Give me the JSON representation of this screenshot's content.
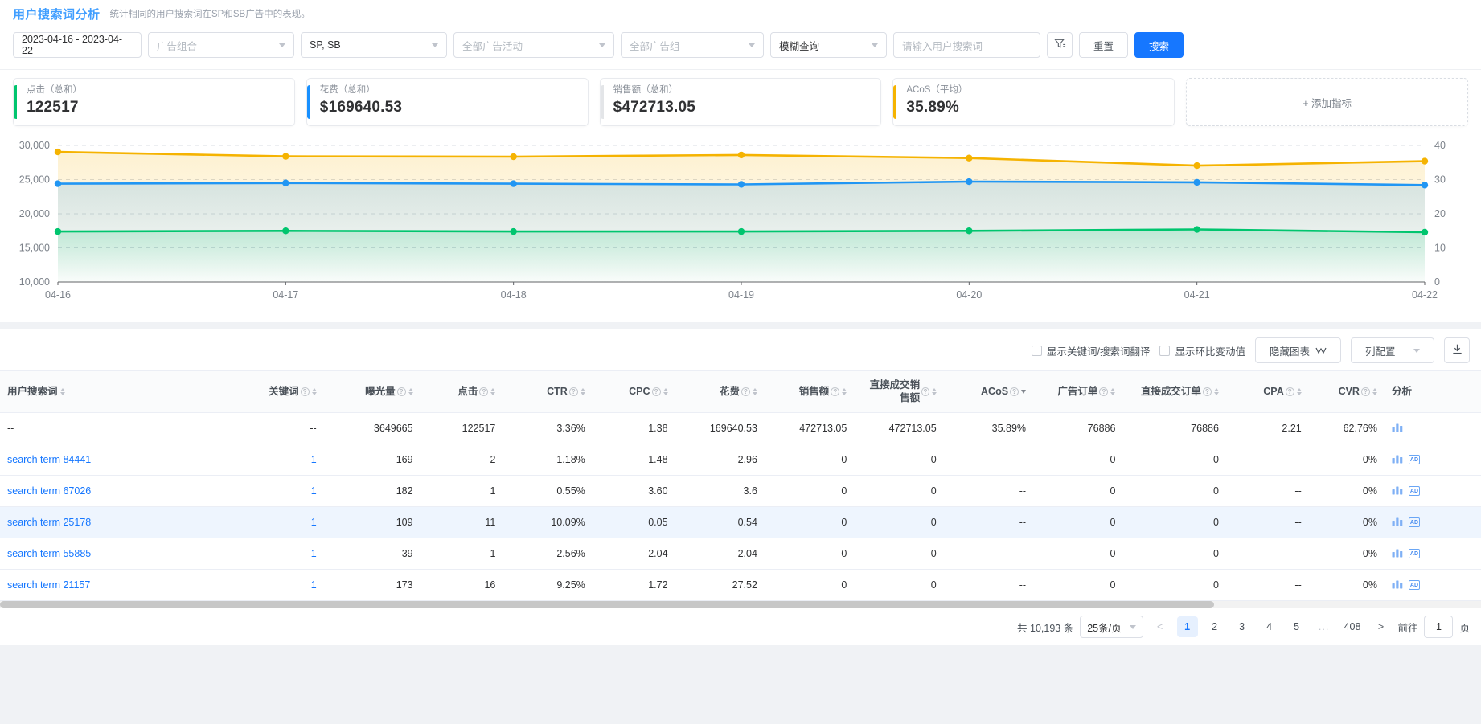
{
  "header": {
    "title": "用户搜索词分析",
    "subtitle": "统计相同的用户搜索词在SP和SB广告中的表现。"
  },
  "filters": {
    "date_range": "2023-04-16 - 2023-04-22",
    "portfolio_placeholder": "广告组合",
    "ad_type_value": "SP, SB",
    "campaign_placeholder": "全部广告活动",
    "adgroup_placeholder": "全部广告组",
    "match_value": "模糊查询",
    "search_term_placeholder": "请输入用户搜索词",
    "filter_icon": "filter-icon",
    "reset_label": "重置",
    "search_label": "搜索"
  },
  "metrics": [
    {
      "label": "点击（总和）",
      "value": "122517",
      "color": "#00c56e"
    },
    {
      "label": "花费（总和）",
      "value": "$169640.53",
      "color": "#1890ff"
    },
    {
      "label": "销售额（总和）",
      "value": "$472713.05",
      "color": "#bdbdbd"
    },
    {
      "label": "ACoS（平均）",
      "value": "35.89%",
      "color": "#f5b301"
    },
    {
      "label": "+ 添加指标",
      "value": "",
      "color": ""
    }
  ],
  "chart_data": {
    "type": "line",
    "title": "",
    "x": [
      "04-16",
      "04-17",
      "04-18",
      "04-19",
      "04-20",
      "04-21",
      "04-22"
    ],
    "left_axis": {
      "label": "",
      "ticks": [
        10000,
        15000,
        20000,
        25000,
        30000
      ],
      "ylim": [
        10000,
        30000
      ]
    },
    "right_axis": {
      "label": "",
      "ticks": [
        0,
        10,
        20,
        30,
        40
      ],
      "ylim": [
        0,
        40
      ]
    },
    "grid": true,
    "legend": "none",
    "series": [
      {
        "name": "ACoS（平均）",
        "axis": "right",
        "color": "#f5b301",
        "values": [
          38.1,
          36.8,
          36.7,
          37.2,
          36.3,
          34.1,
          35.4
        ]
      },
      {
        "name": "花费（总和）",
        "axis": "left",
        "color": "#2196f3",
        "values": [
          24400,
          24500,
          24400,
          24300,
          24700,
          24600,
          24200
        ]
      },
      {
        "name": "点击（总和）",
        "axis": "left",
        "color": "#00c56e",
        "values": [
          17400,
          17500,
          17400,
          17400,
          17500,
          17700,
          17300
        ]
      }
    ]
  },
  "table_tools": {
    "show_translation_label": "显示关键词/搜索词翻译",
    "show_mom_label": "显示环比变动值",
    "hide_chart_label": "隐藏图表",
    "column_config_label": "列配置",
    "export_icon": "download-icon"
  },
  "table": {
    "columns": [
      {
        "label": "用户搜索词",
        "align": "left",
        "help": false,
        "sort": "both",
        "width": "17%"
      },
      {
        "label": "关键词",
        "align": "right",
        "help": true,
        "sort": "both",
        "width": "6.5%"
      },
      {
        "label": "曝光量",
        "align": "right",
        "help": true,
        "sort": "both",
        "width": "7%"
      },
      {
        "label": "点击",
        "align": "right",
        "help": true,
        "sort": "both",
        "width": "6%"
      },
      {
        "label": "CTR",
        "align": "right",
        "help": true,
        "sort": "both",
        "width": "6.5%"
      },
      {
        "label": "CPC",
        "align": "right",
        "help": true,
        "sort": "both",
        "width": "6%"
      },
      {
        "label": "花费",
        "align": "right",
        "help": true,
        "sort": "both",
        "width": "6.5%"
      },
      {
        "label": "销售额",
        "align": "right",
        "help": true,
        "sort": "both",
        "width": "6.5%"
      },
      {
        "label": "直接成交销售额",
        "align": "right",
        "help": true,
        "sort": "both",
        "width": "6.5%"
      },
      {
        "label": "ACoS",
        "align": "right",
        "help": true,
        "sort": "desc",
        "width": "6.5%"
      },
      {
        "label": "广告订单",
        "align": "right",
        "help": true,
        "sort": "both",
        "width": "6.5%"
      },
      {
        "label": "直接成交订单",
        "align": "right",
        "help": true,
        "sort": "both",
        "width": "7.5%"
      },
      {
        "label": "CPA",
        "align": "right",
        "help": true,
        "sort": "both",
        "width": "6%"
      },
      {
        "label": "CVR",
        "align": "right",
        "help": true,
        "sort": "both",
        "width": "5.5%"
      },
      {
        "label": "分析",
        "align": "left",
        "help": false,
        "sort": "none",
        "width": "7%"
      }
    ],
    "rows": [
      {
        "term": "--",
        "term_link": false,
        "keyword": "--",
        "keyword_link": false,
        "impressions": "3649665",
        "clicks": "122517",
        "ctr": "3.36%",
        "cpc": "1.38",
        "spend": "169640.53",
        "sales": "472713.05",
        "direct_sales": "472713.05",
        "acos": "35.89%",
        "ad_orders": "76886",
        "direct_orders": "76886",
        "cpa": "2.21",
        "cvr": "62.76%",
        "icons": [
          "chart-bar-icon"
        ],
        "selected": false
      },
      {
        "term": "search term 84441",
        "term_link": true,
        "keyword": "1",
        "keyword_link": true,
        "impressions": "169",
        "clicks": "2",
        "ctr": "1.18%",
        "cpc": "1.48",
        "spend": "2.96",
        "sales": "0",
        "direct_sales": "0",
        "acos": "--",
        "ad_orders": "0",
        "direct_orders": "0",
        "cpa": "--",
        "cvr": "0%",
        "icons": [
          "chart-bar-icon",
          "ad-icon"
        ],
        "selected": false
      },
      {
        "term": "search term 67026",
        "term_link": true,
        "keyword": "1",
        "keyword_link": true,
        "impressions": "182",
        "clicks": "1",
        "ctr": "0.55%",
        "cpc": "3.60",
        "spend": "3.6",
        "sales": "0",
        "direct_sales": "0",
        "acos": "--",
        "ad_orders": "0",
        "direct_orders": "0",
        "cpa": "--",
        "cvr": "0%",
        "icons": [
          "chart-bar-icon",
          "ad-icon"
        ],
        "selected": false
      },
      {
        "term": "search term 25178",
        "term_link": true,
        "keyword": "1",
        "keyword_link": true,
        "impressions": "109",
        "clicks": "11",
        "ctr": "10.09%",
        "cpc": "0.05",
        "spend": "0.54",
        "sales": "0",
        "direct_sales": "0",
        "acos": "--",
        "ad_orders": "0",
        "direct_orders": "0",
        "cpa": "--",
        "cvr": "0%",
        "icons": [
          "chart-bar-icon",
          "ad-icon"
        ],
        "selected": true
      },
      {
        "term": "search term 55885",
        "term_link": true,
        "keyword": "1",
        "keyword_link": true,
        "impressions": "39",
        "clicks": "1",
        "ctr": "2.56%",
        "cpc": "2.04",
        "spend": "2.04",
        "sales": "0",
        "direct_sales": "0",
        "acos": "--",
        "ad_orders": "0",
        "direct_orders": "0",
        "cpa": "--",
        "cvr": "0%",
        "icons": [
          "chart-bar-icon",
          "ad-icon"
        ],
        "selected": false
      },
      {
        "term": "search term 21157",
        "term_link": true,
        "keyword": "1",
        "keyword_link": true,
        "impressions": "173",
        "clicks": "16",
        "ctr": "9.25%",
        "cpc": "1.72",
        "spend": "27.52",
        "sales": "0",
        "direct_sales": "0",
        "acos": "--",
        "ad_orders": "0",
        "direct_orders": "0",
        "cpa": "--",
        "cvr": "0%",
        "icons": [
          "chart-bar-icon",
          "ad-icon"
        ],
        "selected": false
      }
    ]
  },
  "pagination": {
    "total_text": "共 10,193 条",
    "page_size": "25条/页",
    "prev": "<",
    "pages": [
      "1",
      "2",
      "3",
      "4",
      "5"
    ],
    "ellipsis": "...",
    "last_page": "408",
    "next": ">",
    "jump_label": "前往",
    "jump_value": "1",
    "jump_suffix": "页",
    "active_page": "1"
  },
  "colors": {
    "brand_blue": "#1677ff",
    "green": "#00c56e",
    "orange": "#f5b301",
    "blue_line": "#2196f3"
  }
}
